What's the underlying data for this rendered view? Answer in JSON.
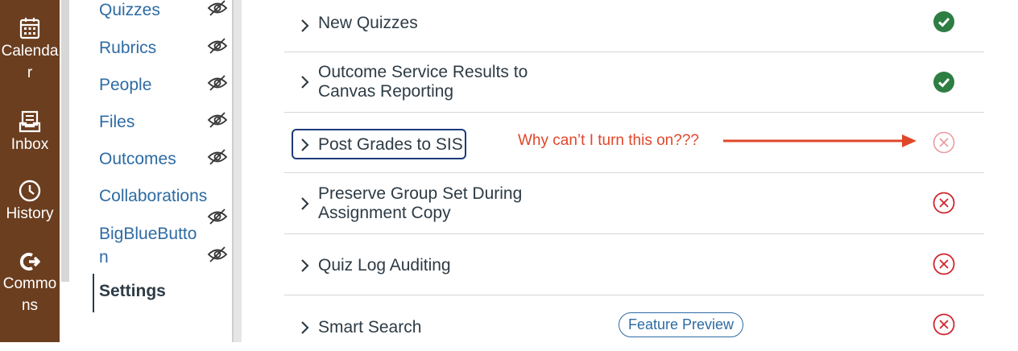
{
  "global_nav": {
    "items": [
      {
        "label": "Calendar",
        "line1": "Calenda",
        "line2": "r",
        "icon": "calendar-icon"
      },
      {
        "label": "Inbox",
        "icon": "inbox-icon"
      },
      {
        "label": "History",
        "icon": "clock-icon"
      },
      {
        "label": "Commons",
        "line1": "Commo",
        "line2": "ns",
        "icon": "commons-icon"
      }
    ]
  },
  "course_nav": {
    "items": [
      {
        "label": "Quizzes",
        "hidden": true
      },
      {
        "label": "Rubrics",
        "hidden": true
      },
      {
        "label": "People",
        "hidden": true
      },
      {
        "label": "Files",
        "hidden": true
      },
      {
        "label": "Outcomes",
        "hidden": true
      },
      {
        "label": "Collaborations",
        "hidden": true
      },
      {
        "label": "BigBlueButton",
        "line1": "BigBlueButto",
        "line2": "n",
        "hidden": true
      }
    ],
    "active": "Settings"
  },
  "features": [
    {
      "title": "New Quizzes",
      "status": "enabled"
    },
    {
      "title_line1": "Outcome Service Results to",
      "title_line2": "Canvas Reporting",
      "status": "enabled"
    },
    {
      "title": "Post Grades to SIS",
      "status": "disabled-locked"
    },
    {
      "title_line1": "Preserve Group Set During",
      "title_line2": "Assignment Copy",
      "status": "disabled"
    },
    {
      "title": "Quiz Log Auditing",
      "status": "disabled"
    },
    {
      "title": "Smart Search",
      "status": "disabled",
      "badge": "Feature Preview"
    }
  ],
  "annotation": "Why can’t I turn this on???",
  "colors": {
    "nav_bg": "#6b3e1f",
    "link": "#2d6ba3",
    "enabled": "#2e7d43",
    "disabled": "#d0262e",
    "annotation": "#e0472a",
    "focus_ring": "#1f3a7a"
  }
}
